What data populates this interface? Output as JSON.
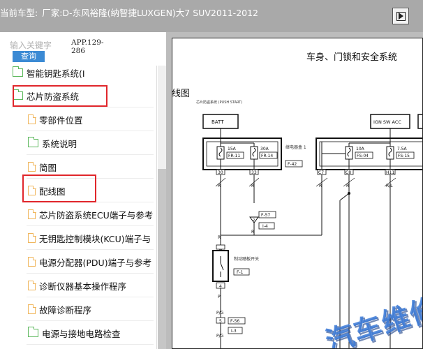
{
  "header": {
    "label": "当前车型:",
    "vehicle": "厂家:D-东风裕隆(纳智捷LUXGEN)大7 SUV2011-2012"
  },
  "search": {
    "placeholder": "输入关键字",
    "button_label": "查询",
    "app_code": "APP.129-286"
  },
  "tree": [
    {
      "type": "folder",
      "label": "智能钥匙系统(I"
    },
    {
      "type": "folder",
      "label": "芯片防盗系统",
      "highlighted": true
    },
    {
      "type": "doc",
      "label": "零部件位置"
    },
    {
      "type": "folder",
      "label": "系统说明"
    },
    {
      "type": "doc",
      "label": "简图"
    },
    {
      "type": "doc",
      "label": "配线图",
      "highlighted": true
    },
    {
      "type": "doc",
      "label": "芯片防盗系统ECU端子与参考"
    },
    {
      "type": "doc",
      "label": "无钥匙控制模块(KCU)端子与"
    },
    {
      "type": "doc",
      "label": "电源分配器(PDU)端子与参考"
    },
    {
      "type": "doc",
      "label": "诊断仪器基本操作程序"
    },
    {
      "type": "doc",
      "label": "故障诊断程序"
    },
    {
      "type": "folder",
      "label": "电源与接地电路检查"
    }
  ],
  "document": {
    "title": "车身、门锁和安全系统",
    "section": "配线图",
    "watermark": "汽车维修"
  },
  "wiring": {
    "caption": "芯片防盗系统 (PUSH START)",
    "batt": "BATT",
    "ign": "IGN SW ACC",
    "fuse_box_label": "继电器盒 1",
    "fuses": [
      {
        "amp": "15A",
        "id": "FR-11",
        "pin": "30"
      },
      {
        "amp": "30A",
        "id": "FR-14",
        "pin": "33"
      },
      {
        "amp": "10A",
        "id": "FS-04",
        "pin": "C8"
      },
      {
        "amp": "7.5A",
        "id": "FS-15",
        "pin": "H11"
      }
    ],
    "box_code": "F-42",
    "c7": "C7",
    "wire_r": "R",
    "wire_rl": "R/L",
    "wire_p": "P",
    "wire_pg": "P/G",
    "conn_f57": "F-57",
    "conn_i4": "I-4",
    "pin_2": "2",
    "switch_label": "制动踏板开关",
    "switch_code": "F-1",
    "pin_4": "4",
    "pin_5": "5",
    "conn_f56": "F-56",
    "conn_i3": "I-3"
  },
  "colors": {
    "header_bg": "#a9a9a9",
    "search_button": "#3b8ad4",
    "folder_icon": "#5cb85c",
    "doc_icon": "#f0b65c",
    "highlight_box": "#e0262b",
    "watermark": "#3c7bd8"
  }
}
